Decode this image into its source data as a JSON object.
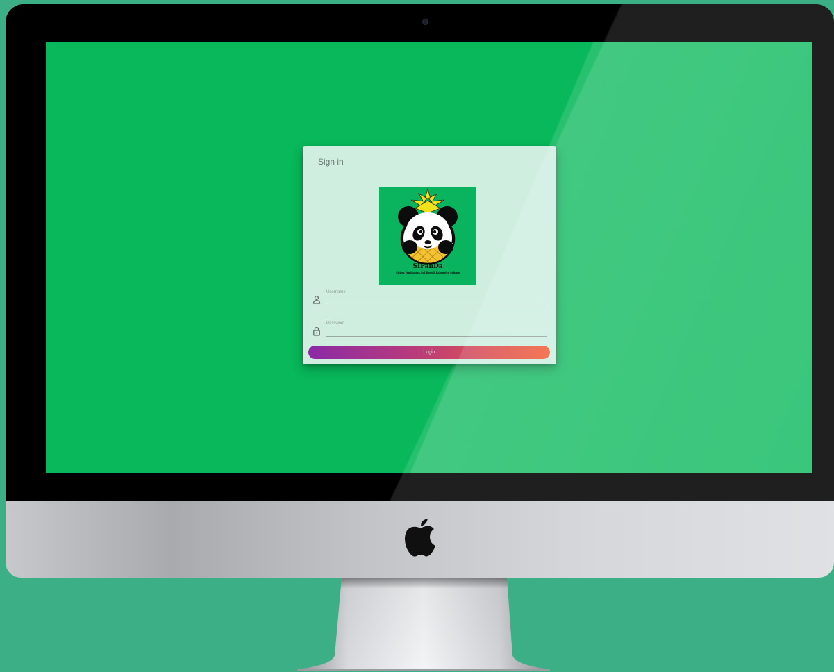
{
  "login": {
    "title": "Sign in",
    "logo": {
      "name": "SIPanDa",
      "tagline": "Sistem Pendapatan Asli Daerah Kabupaten Subang"
    },
    "username": {
      "label": "Username",
      "icon": "user-icon"
    },
    "password": {
      "label": "Password",
      "icon": "lock-icon"
    },
    "login_label": "Login"
  },
  "colors": {
    "page_background": "#3daf87",
    "screen_background": "#08b85a",
    "card_background": "#cfeee0",
    "button_gradient_start": "#8b2aa6",
    "button_gradient_end": "#f3643d"
  }
}
